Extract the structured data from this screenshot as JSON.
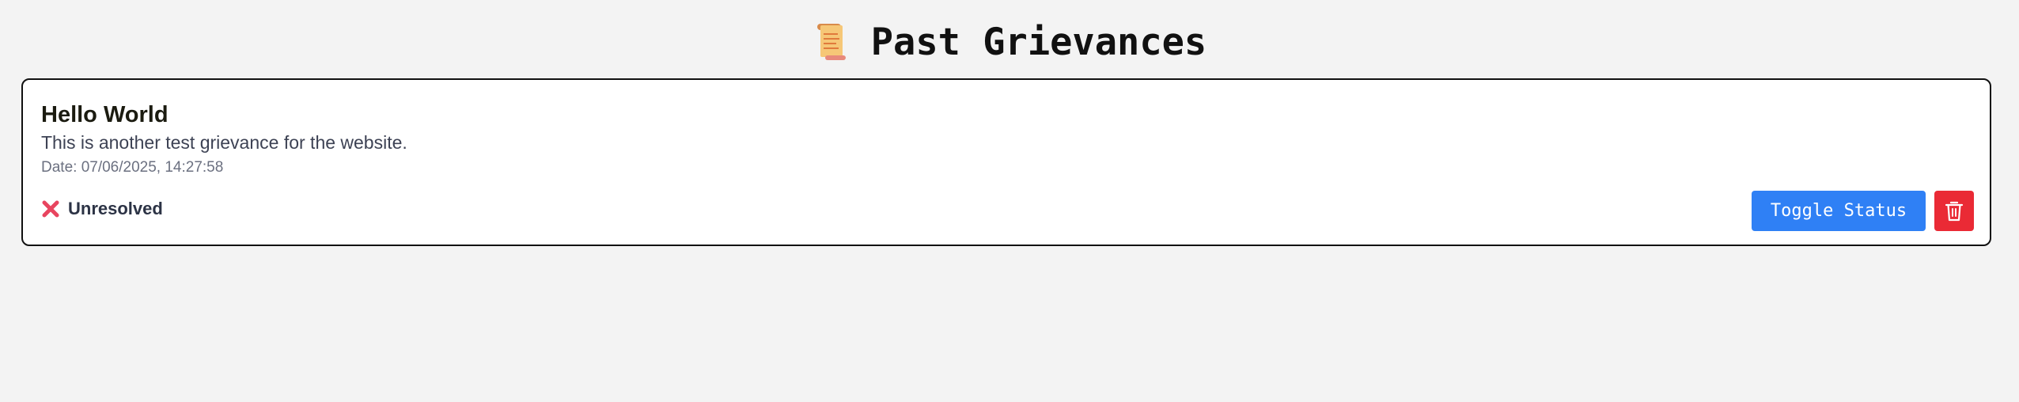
{
  "header": {
    "title": "Past Grievances",
    "icon": "scroll-icon"
  },
  "grievances": [
    {
      "title": "Hello World",
      "description": "This is another test grievance for the website.",
      "date": "Date: 07/06/2025, 14:27:58",
      "status": {
        "icon": "cross-mark-icon",
        "label": "Unresolved",
        "color": "#e8455f"
      },
      "actions": {
        "toggle_label": "Toggle Status",
        "delete_icon": "trash-icon"
      }
    }
  ],
  "colors": {
    "background": "#f3f3f3",
    "card_border": "#111111",
    "toggle_button": "#2f80f5",
    "delete_button": "#ea2a35"
  }
}
